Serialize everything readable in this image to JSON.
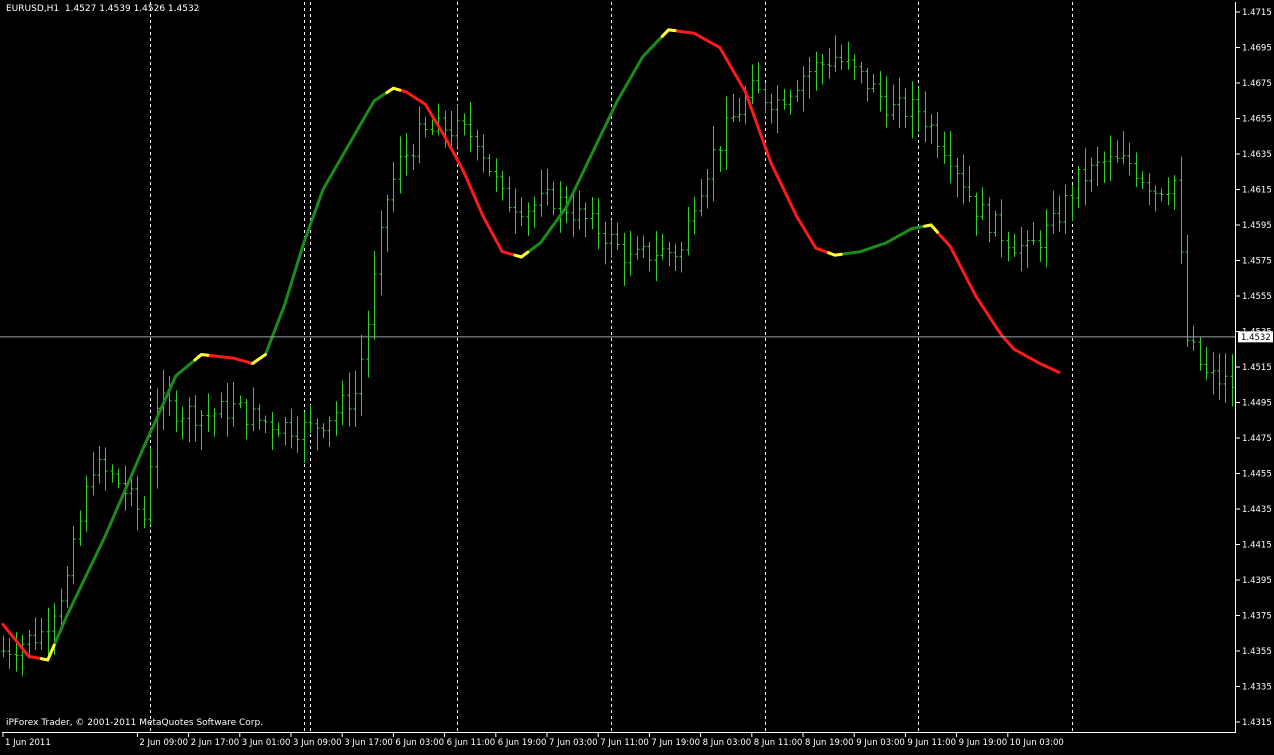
{
  "header": {
    "symbol": "EURUSD,H1",
    "ohlc": "1.4527 1.4539 1.4526 1.4532"
  },
  "footer": {
    "copyright": "iPForex Trader, © 2001-2011 MetaQuotes Software Corp."
  },
  "colors": {
    "background": "#000000",
    "bars": "#32cd32",
    "ma_up": "#1a8c1a",
    "ma_down": "#ff1a1a",
    "ma_turn": "#ffff33",
    "grid": "#ffffff",
    "price_line": "#9aa3ad"
  },
  "chart_data": {
    "type": "line",
    "current_price": 1.4532,
    "current_price_label": "1.4532",
    "ylim": [
      1.4315,
      1.4715
    ],
    "y_ticks": [
      "1.4715",
      "1.4695",
      "1.4675",
      "1.4655",
      "1.4635",
      "1.4615",
      "1.4595",
      "1.4575",
      "1.4555",
      "1.4535",
      "1.4515",
      "1.4495",
      "1.4475",
      "1.4455",
      "1.4435",
      "1.4415",
      "1.4395",
      "1.4375",
      "1.4355",
      "1.4335",
      "1.4315"
    ],
    "x_ticks": [
      {
        "label": "1 Jun 2011",
        "bar": 0
      },
      {
        "label": "2 Jun 09:00",
        "bar": 21
      },
      {
        "label": "2 Jun 17:00",
        "bar": 29
      },
      {
        "label": "3 Jun 01:00",
        "bar": 37
      },
      {
        "label": "3 Jun 09:00",
        "bar": 45
      },
      {
        "label": "3 Jun 17:00",
        "bar": 53
      },
      {
        "label": "6 Jun 03:00",
        "bar": 61
      },
      {
        "label": "6 Jun 11:00",
        "bar": 69
      },
      {
        "label": "6 Jun 19:00",
        "bar": 77
      },
      {
        "label": "7 Jun 03:00",
        "bar": 85
      },
      {
        "label": "7 Jun 11:00",
        "bar": 93
      },
      {
        "label": "7 Jun 19:00",
        "bar": 101
      },
      {
        "label": "8 Jun 03:00",
        "bar": 109
      },
      {
        "label": "8 Jun 11:00",
        "bar": 117
      },
      {
        "label": "8 Jun 19:00",
        "bar": 125
      },
      {
        "label": "9 Jun 03:00",
        "bar": 133
      },
      {
        "label": "9 Jun 11:00",
        "bar": 141
      },
      {
        "label": "9 Jun 19:00",
        "bar": 149
      },
      {
        "label": "10 Jun 03:00",
        "bar": 157
      }
    ],
    "day_separators": [
      23,
      47,
      48,
      71,
      95,
      119,
      143,
      167
    ],
    "bar_count": 174,
    "price_path": [
      [
        0,
        1.4355
      ],
      [
        6,
        1.4365
      ],
      [
        10,
        1.4395
      ],
      [
        14,
        1.446
      ],
      [
        18,
        1.445
      ],
      [
        22,
        1.443
      ],
      [
        24,
        1.4495
      ],
      [
        28,
        1.449
      ],
      [
        32,
        1.4488
      ],
      [
        36,
        1.4492
      ],
      [
        40,
        1.4485
      ],
      [
        44,
        1.4482
      ],
      [
        48,
        1.448
      ],
      [
        52,
        1.449
      ],
      [
        55,
        1.45
      ],
      [
        57,
        1.454
      ],
      [
        60,
        1.461
      ],
      [
        62,
        1.463
      ],
      [
        65,
        1.4645
      ],
      [
        69,
        1.465
      ],
      [
        74,
        1.4645
      ],
      [
        78,
        1.461
      ],
      [
        82,
        1.4605
      ],
      [
        86,
        1.461
      ],
      [
        90,
        1.46
      ],
      [
        94,
        1.459
      ],
      [
        98,
        1.4575
      ],
      [
        102,
        1.458
      ],
      [
        106,
        1.458
      ],
      [
        108,
        1.461
      ],
      [
        111,
        1.4635
      ],
      [
        114,
        1.4655
      ],
      [
        117,
        1.467
      ],
      [
        121,
        1.4665
      ],
      [
        125,
        1.468
      ],
      [
        130,
        1.469
      ],
      [
        135,
        1.4675
      ],
      [
        139,
        1.466
      ],
      [
        143,
        1.466
      ],
      [
        148,
        1.4635
      ],
      [
        152,
        1.4605
      ],
      [
        156,
        1.459
      ],
      [
        160,
        1.458
      ],
      [
        164,
        1.4595
      ],
      [
        168,
        1.462
      ],
      [
        172,
        1.463
      ],
      [
        176,
        1.463
      ],
      [
        180,
        1.4615
      ],
      [
        183,
        1.462
      ],
      [
        185,
        1.453
      ],
      [
        188,
        1.451
      ],
      [
        192,
        1.4505
      ],
      [
        196,
        1.4505
      ],
      [
        200,
        1.452
      ],
      [
        204,
        1.453
      ]
    ],
    "ma_line": [
      [
        0,
        1.437
      ],
      [
        4,
        1.4352
      ],
      [
        7,
        1.435
      ],
      [
        10,
        1.4375
      ],
      [
        16,
        1.442
      ],
      [
        22,
        1.447
      ],
      [
        27,
        1.451
      ],
      [
        31,
        1.4522
      ],
      [
        36,
        1.452
      ],
      [
        39,
        1.4517
      ],
      [
        41,
        1.4522
      ],
      [
        44,
        1.455
      ],
      [
        47,
        1.4585
      ],
      [
        50,
        1.4615
      ],
      [
        54,
        1.464
      ],
      [
        58,
        1.4665
      ],
      [
        61,
        1.4672
      ],
      [
        63,
        1.467
      ],
      [
        66,
        1.4663
      ],
      [
        69,
        1.4645
      ],
      [
        72,
        1.4625
      ],
      [
        75,
        1.46
      ],
      [
        78,
        1.458
      ],
      [
        81,
        1.4577
      ],
      [
        84,
        1.4585
      ],
      [
        88,
        1.4605
      ],
      [
        92,
        1.4635
      ],
      [
        96,
        1.4665
      ],
      [
        100,
        1.469
      ],
      [
        104,
        1.4705
      ],
      [
        108,
        1.4703
      ],
      [
        112,
        1.4695
      ],
      [
        116,
        1.467
      ],
      [
        120,
        1.463
      ],
      [
        124,
        1.46
      ],
      [
        127,
        1.4582
      ],
      [
        130,
        1.4578
      ],
      [
        134,
        1.458
      ],
      [
        138,
        1.4585
      ],
      [
        142,
        1.4593
      ],
      [
        145,
        1.4595
      ],
      [
        148,
        1.4583
      ],
      [
        152,
        1.4555
      ],
      [
        156,
        1.4533
      ],
      [
        158,
        1.4525
      ],
      [
        162,
        1.4517
      ],
      [
        165,
        1.4512
      ]
    ],
    "ma_segments": [
      {
        "from": 0,
        "to": 7,
        "trend": "down"
      },
      {
        "from": 7,
        "to": 31,
        "trend": "up"
      },
      {
        "from": 31,
        "to": 40,
        "trend": "down"
      },
      {
        "from": 40,
        "to": 61,
        "trend": "up"
      },
      {
        "from": 61,
        "to": 81,
        "trend": "down"
      },
      {
        "from": 81,
        "to": 104,
        "trend": "up"
      },
      {
        "from": 104,
        "to": 130,
        "trend": "down"
      },
      {
        "from": 130,
        "to": 145,
        "trend": "up"
      },
      {
        "from": 145,
        "to": 165,
        "trend": "down"
      }
    ]
  }
}
